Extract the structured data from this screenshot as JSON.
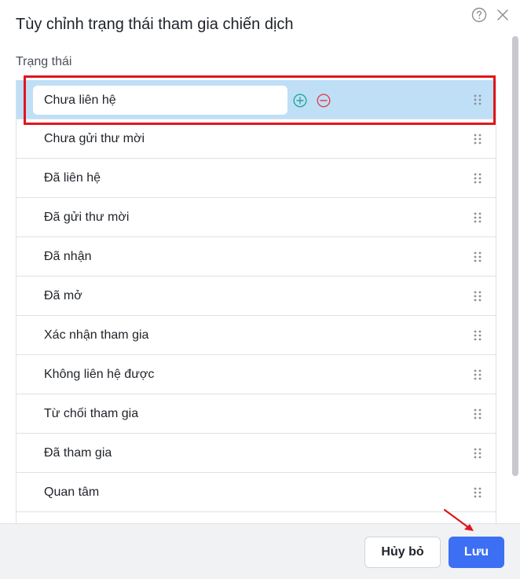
{
  "dialog": {
    "title": "Tùy chỉnh trạng thái tham gia chiến dịch",
    "field_label": "Trạng thái"
  },
  "status_list": {
    "editing_value": "Chưa liên hệ",
    "items": [
      "Chưa gửi thư mời",
      "Đã liên hệ",
      "Đã gửi thư mời",
      "Đã nhận",
      "Đã mở",
      "Xác nhận tham gia",
      "Không liên hệ được",
      "Từ chối tham gia",
      "Đã tham gia",
      "Quan tâm"
    ]
  },
  "footer": {
    "cancel_label": "Hủy bỏ",
    "save_label": "Lưu"
  },
  "colors": {
    "selected_row": "#bfdff7",
    "primary_button": "#3d6ff5",
    "add_icon": "#24a89a",
    "remove_icon": "#e0434a",
    "annotation_red": "#e0161c"
  }
}
